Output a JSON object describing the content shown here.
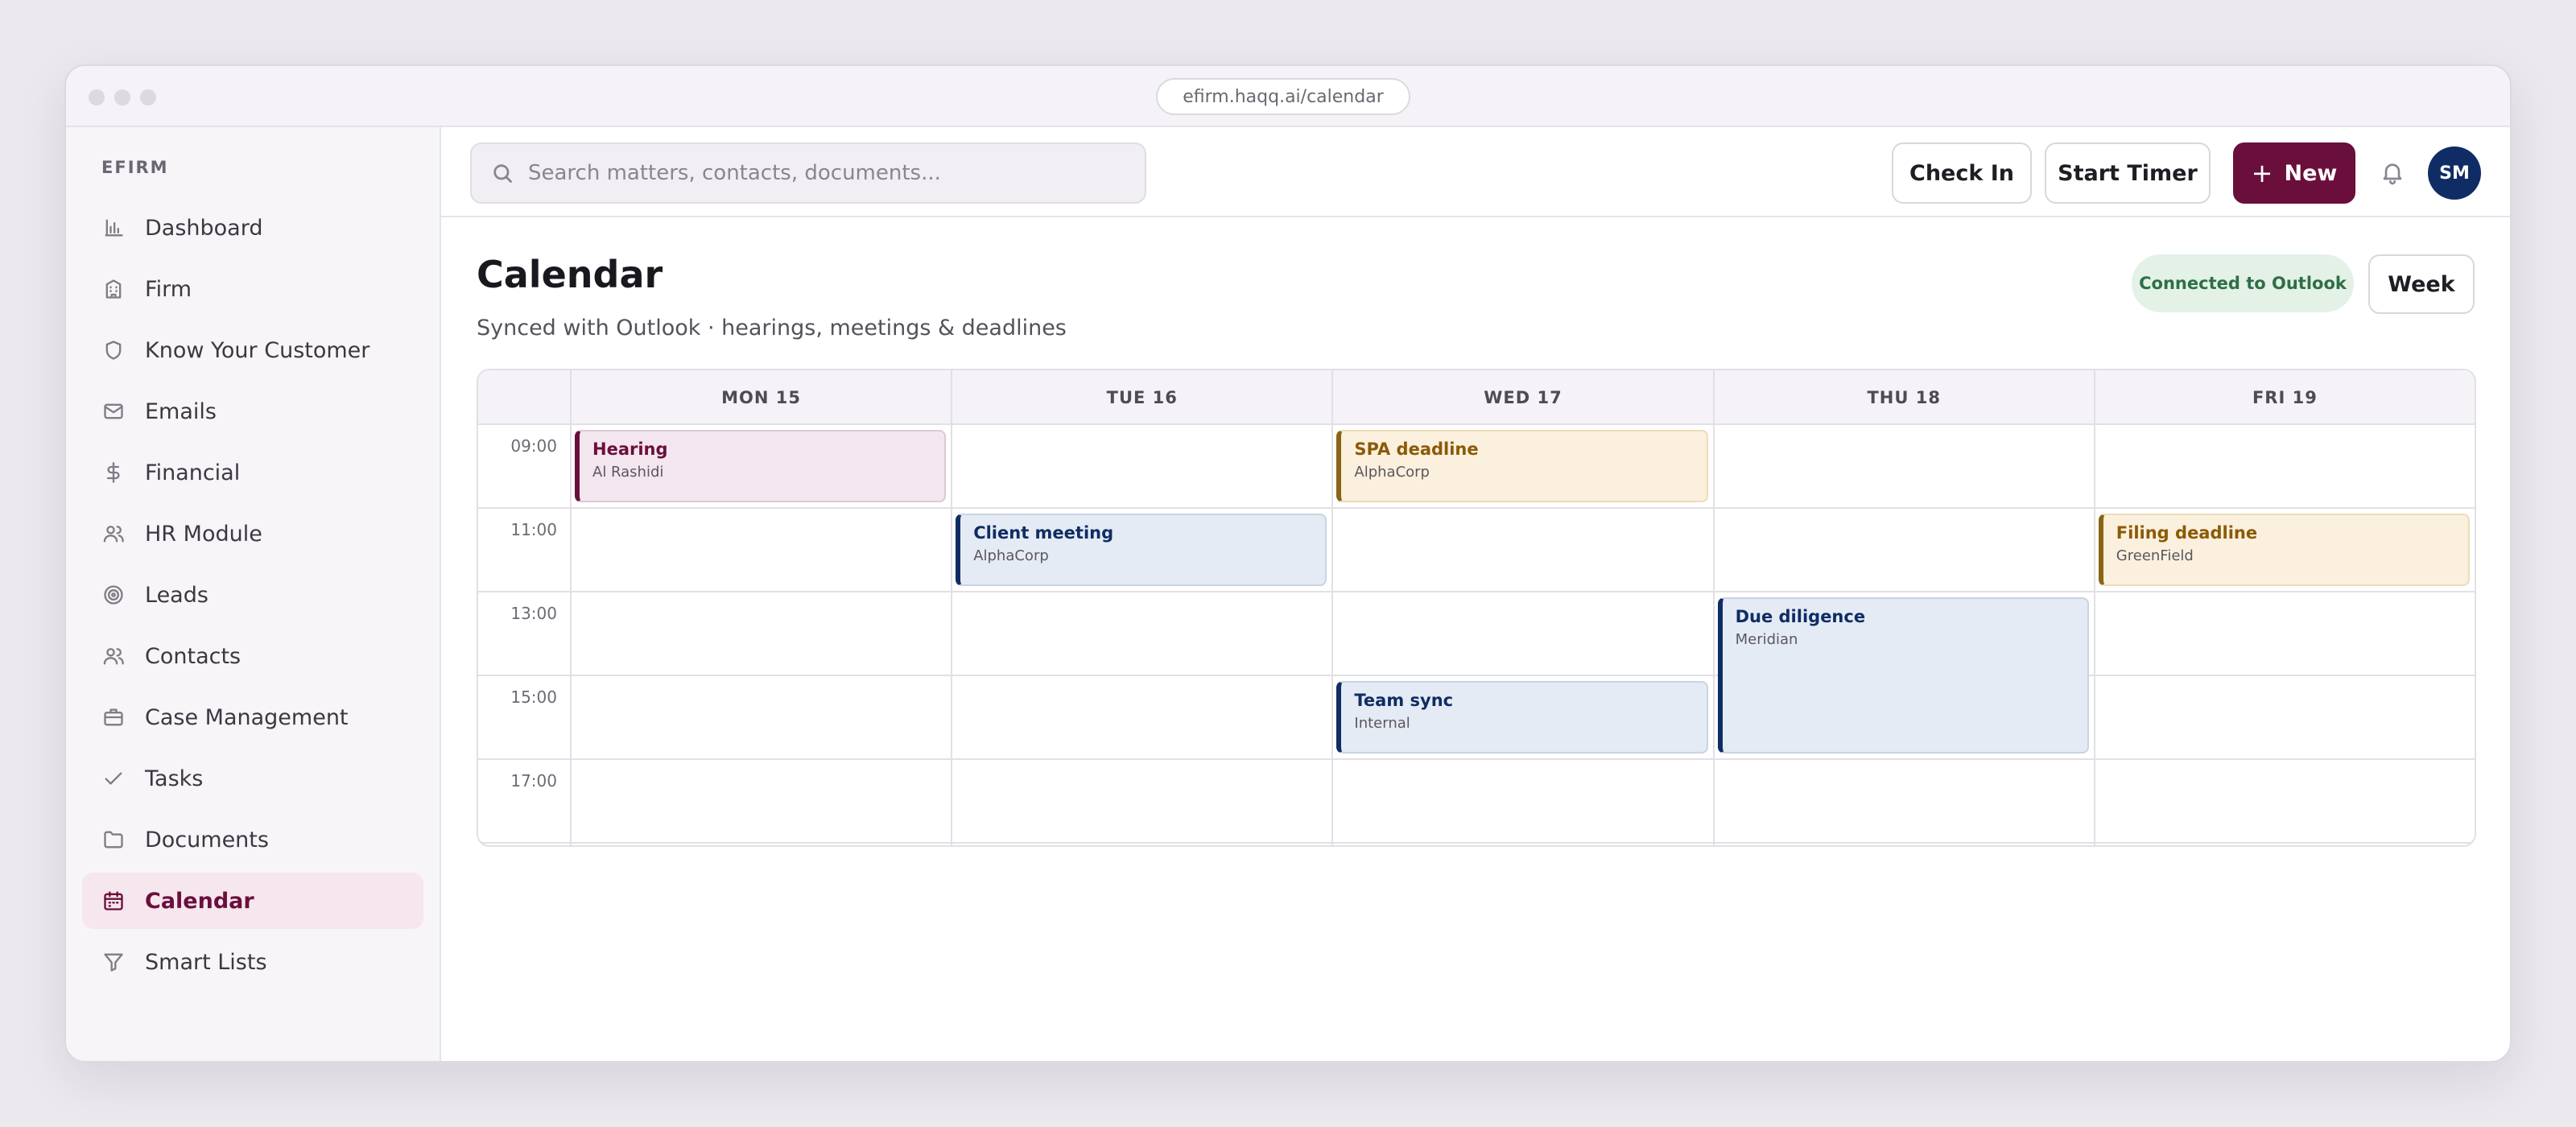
{
  "browser": {
    "url": "efirm.haqq.ai/calendar"
  },
  "sidebar": {
    "brand": "EFIRM",
    "items": [
      {
        "label": "Dashboard",
        "icon": "bar-chart-icon",
        "active": false
      },
      {
        "label": "Firm",
        "icon": "building-icon",
        "active": false
      },
      {
        "label": "Know Your Customer",
        "icon": "shield-icon",
        "active": false
      },
      {
        "label": "Emails",
        "icon": "mail-icon",
        "active": false
      },
      {
        "label": "Financial",
        "icon": "dollar-icon",
        "active": false
      },
      {
        "label": "HR Module",
        "icon": "users-icon",
        "active": false
      },
      {
        "label": "Leads",
        "icon": "target-icon",
        "active": false
      },
      {
        "label": "Contacts",
        "icon": "users-icon",
        "active": false
      },
      {
        "label": "Case Management",
        "icon": "briefcase-icon",
        "active": false
      },
      {
        "label": "Tasks",
        "icon": "check-icon",
        "active": false
      },
      {
        "label": "Documents",
        "icon": "folder-icon",
        "active": false
      },
      {
        "label": "Calendar",
        "icon": "calendar-icon",
        "active": true
      },
      {
        "label": "Smart Lists",
        "icon": "filter-icon",
        "active": false
      }
    ]
  },
  "topbar": {
    "search_placeholder": "Search matters, contacts, documents...",
    "check_in_label": "Check In",
    "start_timer_label": "Start Timer",
    "new_label": "New",
    "avatar_initials": "SM"
  },
  "page": {
    "title": "Calendar",
    "subtitle": "Synced with Outlook · hearings, meetings & deadlines",
    "sync_badge": "Connected to Outlook",
    "view_label": "Week"
  },
  "calendar": {
    "days": [
      "MON 15",
      "TUE 16",
      "WED 17",
      "THU 18",
      "FRI 19"
    ],
    "times": [
      "09:00",
      "11:00",
      "13:00",
      "15:00",
      "17:00"
    ],
    "events": [
      {
        "title": "Hearing",
        "subtitle": "Al Rashidi",
        "day": 0,
        "slot": 0,
        "span": 1,
        "style": "rose"
      },
      {
        "title": "SPA deadline",
        "subtitle": "AlphaCorp",
        "day": 2,
        "slot": 0,
        "span": 1,
        "style": "amber"
      },
      {
        "title": "Client meeting",
        "subtitle": "AlphaCorp",
        "day": 1,
        "slot": 1,
        "span": 1,
        "style": "blue"
      },
      {
        "title": "Filing deadline",
        "subtitle": "GreenField",
        "day": 4,
        "slot": 1,
        "span": 1,
        "style": "amber"
      },
      {
        "title": "Due diligence",
        "subtitle": "Meridian",
        "day": 3,
        "slot": 2,
        "span": 2,
        "style": "blue"
      },
      {
        "title": "Team sync",
        "subtitle": "Internal",
        "day": 2,
        "slot": 3,
        "span": 1,
        "style": "blue"
      }
    ]
  },
  "colors": {
    "brand": "#6a0f3c",
    "avatar": "#0f2d64",
    "sync_badge_bg": "#e3f1e7",
    "sync_badge_text": "#2f6e46"
  }
}
